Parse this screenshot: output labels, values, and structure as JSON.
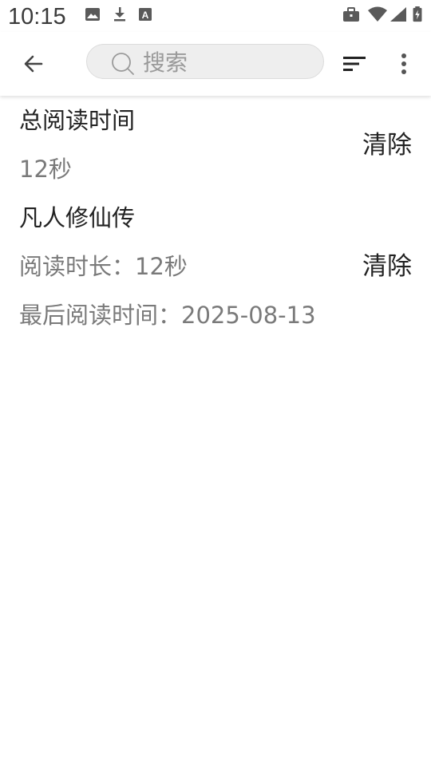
{
  "status_bar": {
    "time": "10:15",
    "left_icons": [
      "image-icon",
      "download-icon",
      "a-box-icon"
    ],
    "right_icons": [
      "briefcase-icon",
      "wifi-icon",
      "signal-icon",
      "battery-charging-icon"
    ]
  },
  "toolbar": {
    "back_icon": "arrow-left-icon",
    "search_placeholder": "搜索",
    "search_value": "",
    "sort_icon": "sort-icon",
    "more_icon": "more-vertical-icon"
  },
  "summary": {
    "title": "总阅读时间",
    "value": "12秒",
    "clear_label": "清除"
  },
  "books": [
    {
      "name": "凡人修仙传",
      "duration": "阅读时长：12秒",
      "last_read": "最后阅读时间：2025-08-13",
      "clear_label": "清除"
    }
  ],
  "colors": {
    "primary_text": "#222222",
    "secondary_text": "#7a7a7a",
    "search_bg": "#eeeeee"
  }
}
